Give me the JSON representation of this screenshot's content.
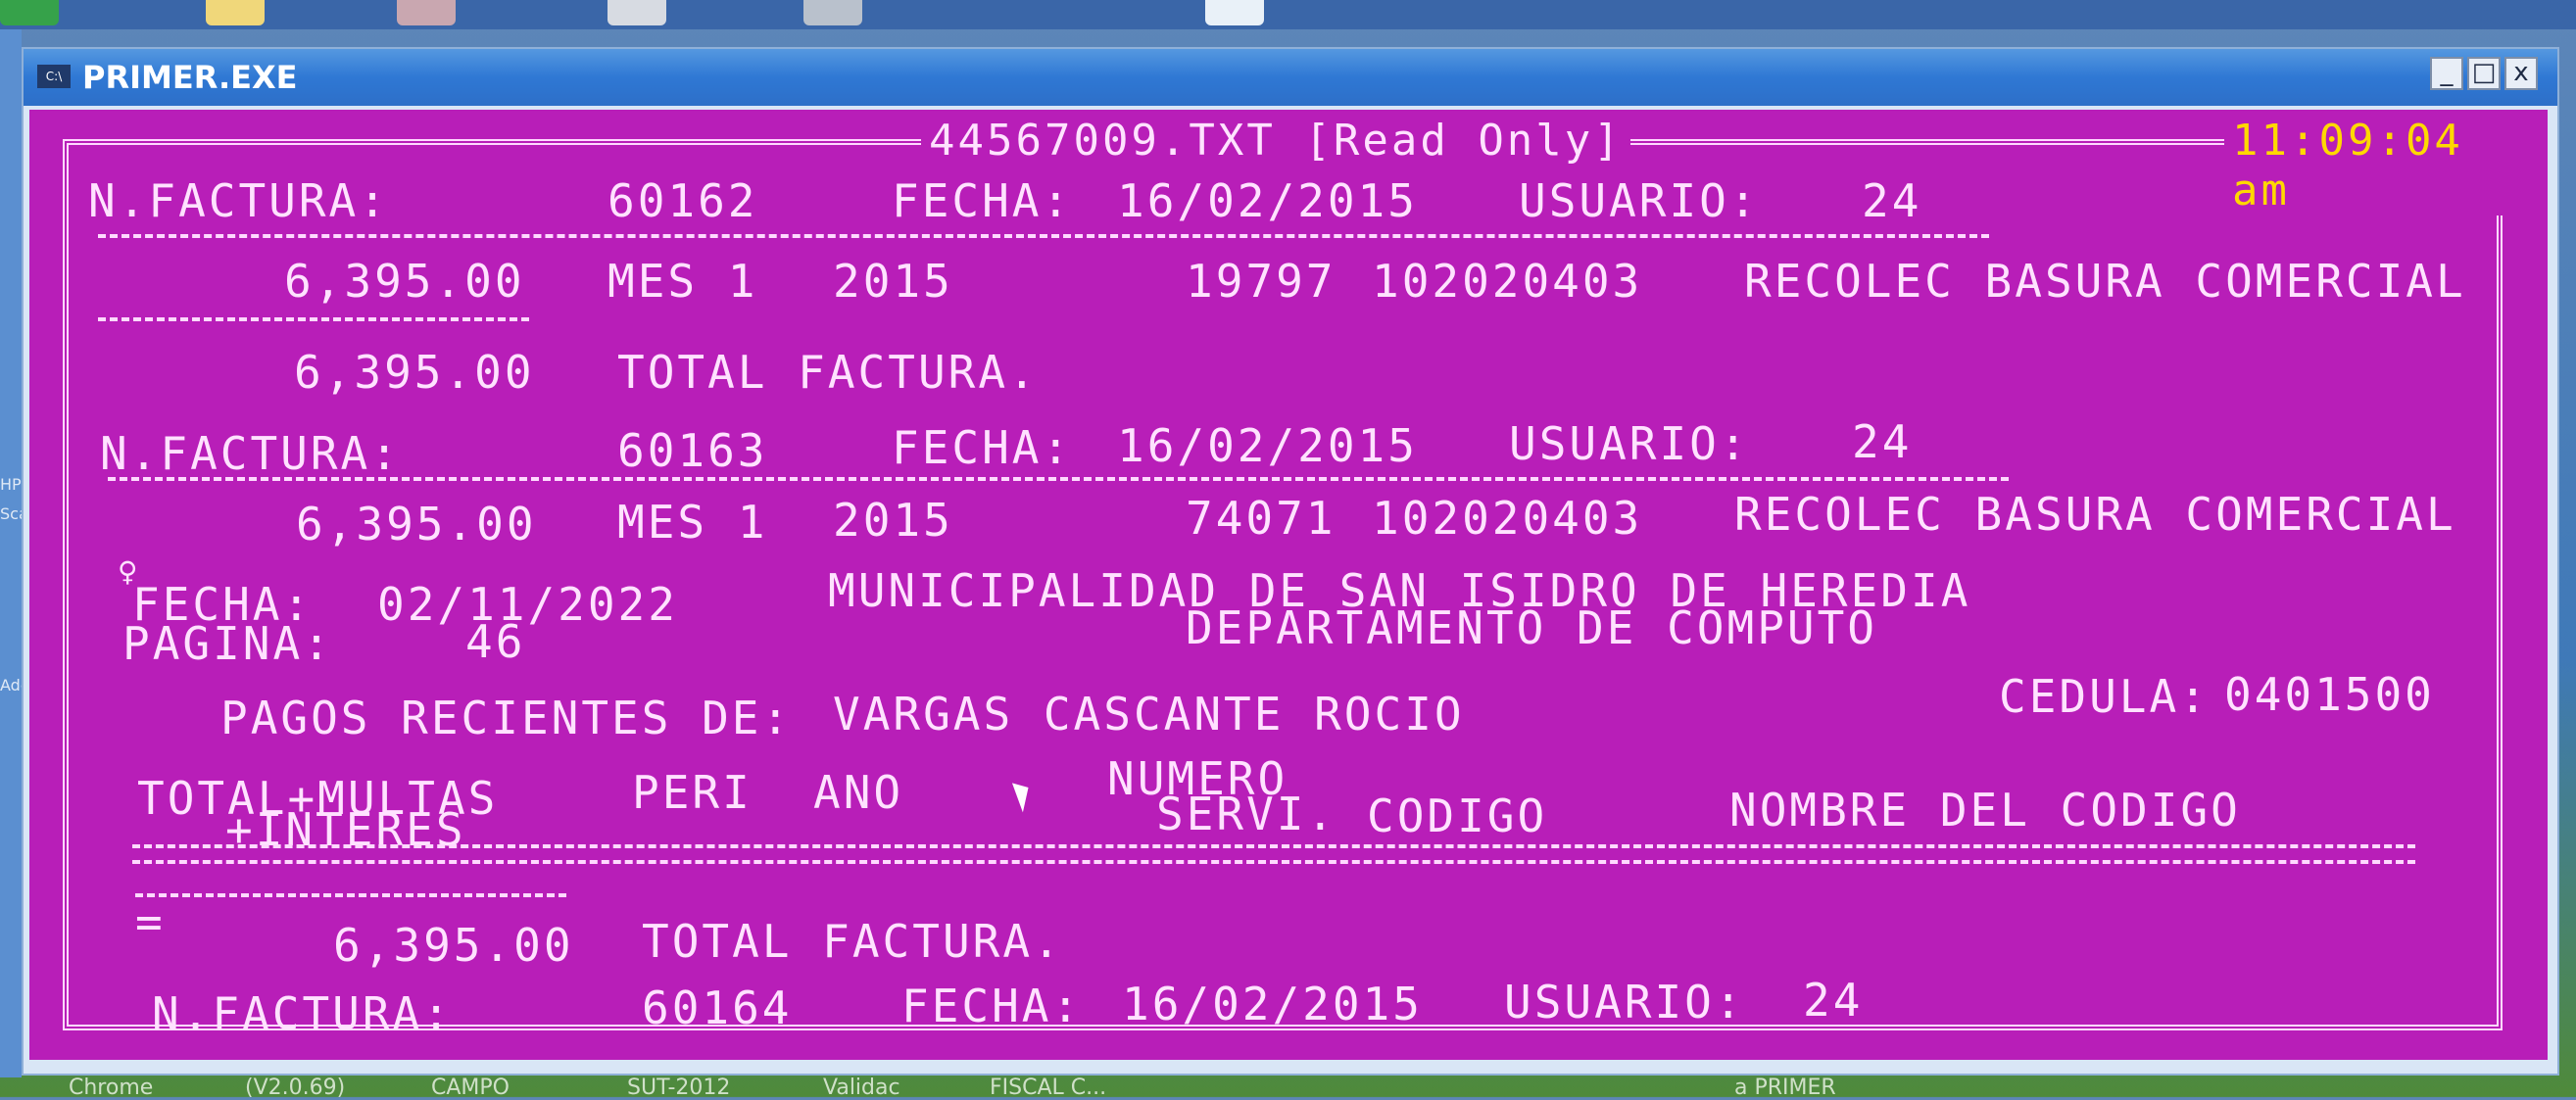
{
  "window": {
    "title": "PRIMER.EXE",
    "icon_text": "C:\\",
    "min_label": "_",
    "max_label": "□",
    "close_label": "x"
  },
  "console": {
    "file_title": "44567009.TXT [Read Only]",
    "clock": "11:09:04 am",
    "invoice1": {
      "nf_label": "N.FACTURA:",
      "nf_value": "60162",
      "fecha_label": "FECHA:",
      "fecha_value": "16/02/2015",
      "usuario_label": "USUARIO:",
      "usuario_value": "24",
      "line_amount": "6,395.00",
      "line_mes": "MES 1",
      "line_year": "2015",
      "line_serv": "19797",
      "line_code": "102020403",
      "line_desc": "RECOLEC BASURA COMERCIAL",
      "total_amount": "6,395.00",
      "total_label": "TOTAL FACTURA."
    },
    "invoice2": {
      "nf_label": "N.FACTURA:",
      "nf_value": "60163",
      "fecha_label": "FECHA:",
      "fecha_value": "16/02/2015",
      "usuario_label": "USUARIO:",
      "usuario_value": "24",
      "line_amount": "6,395.00",
      "line_mes": "MES 1",
      "line_year": "2015",
      "line_serv": "74071",
      "line_code": "102020403",
      "line_desc": "RECOLEC BASURA COMERCIAL"
    },
    "report": {
      "symbol": "♀",
      "fecha_label": "FECHA:",
      "fecha_value": "02/11/2022",
      "municipality": "MUNICIPALIDAD DE SAN ISIDRO DE HEREDIA",
      "pagina_label": "PAGINA:",
      "pagina_value": "46",
      "department": "DEPARTAMENTO DE COMPUTO",
      "pagos_label": "PAGOS RECIENTES DE:",
      "pagos_name": "VARGAS CASCANTE ROCIO",
      "cedula_label": "CEDULA:",
      "cedula_value": "0401500"
    },
    "columns": {
      "total_multas": "TOTAL+MULTAS",
      "interes": "+INTERES",
      "peri": "PERI",
      "ano": "ANO",
      "numero": "NUMERO",
      "servi": "SERVI.",
      "codigo": "CODIGO",
      "nombre_codigo": "NOMBRE DEL CODIGO"
    },
    "footer": {
      "dash_mark": "=",
      "total_amount": "6,395.00",
      "total_label": "TOTAL FACTURA.",
      "nf_label": "N.FACTURA:",
      "nf_value": "60164",
      "fecha_label": "FECHA:",
      "fecha_value": "16/02/2015",
      "usuario_label": "USUARIO:",
      "usuario_value": "24"
    }
  },
  "desktop": {
    "left_labels": [
      "HP",
      "Sca",
      "Ado"
    ],
    "taskbar_labels": [
      "Chrome",
      "(V2.0.69)",
      "CAMPO",
      "SUT-2012",
      "Validac",
      "FISCAL C...",
      "a PRIMER"
    ]
  },
  "colors": {
    "console_bg": "#b81eb8",
    "console_text": "#ffe2ff",
    "clock_text": "#ffd800",
    "titlebar": "#2f78d4"
  }
}
